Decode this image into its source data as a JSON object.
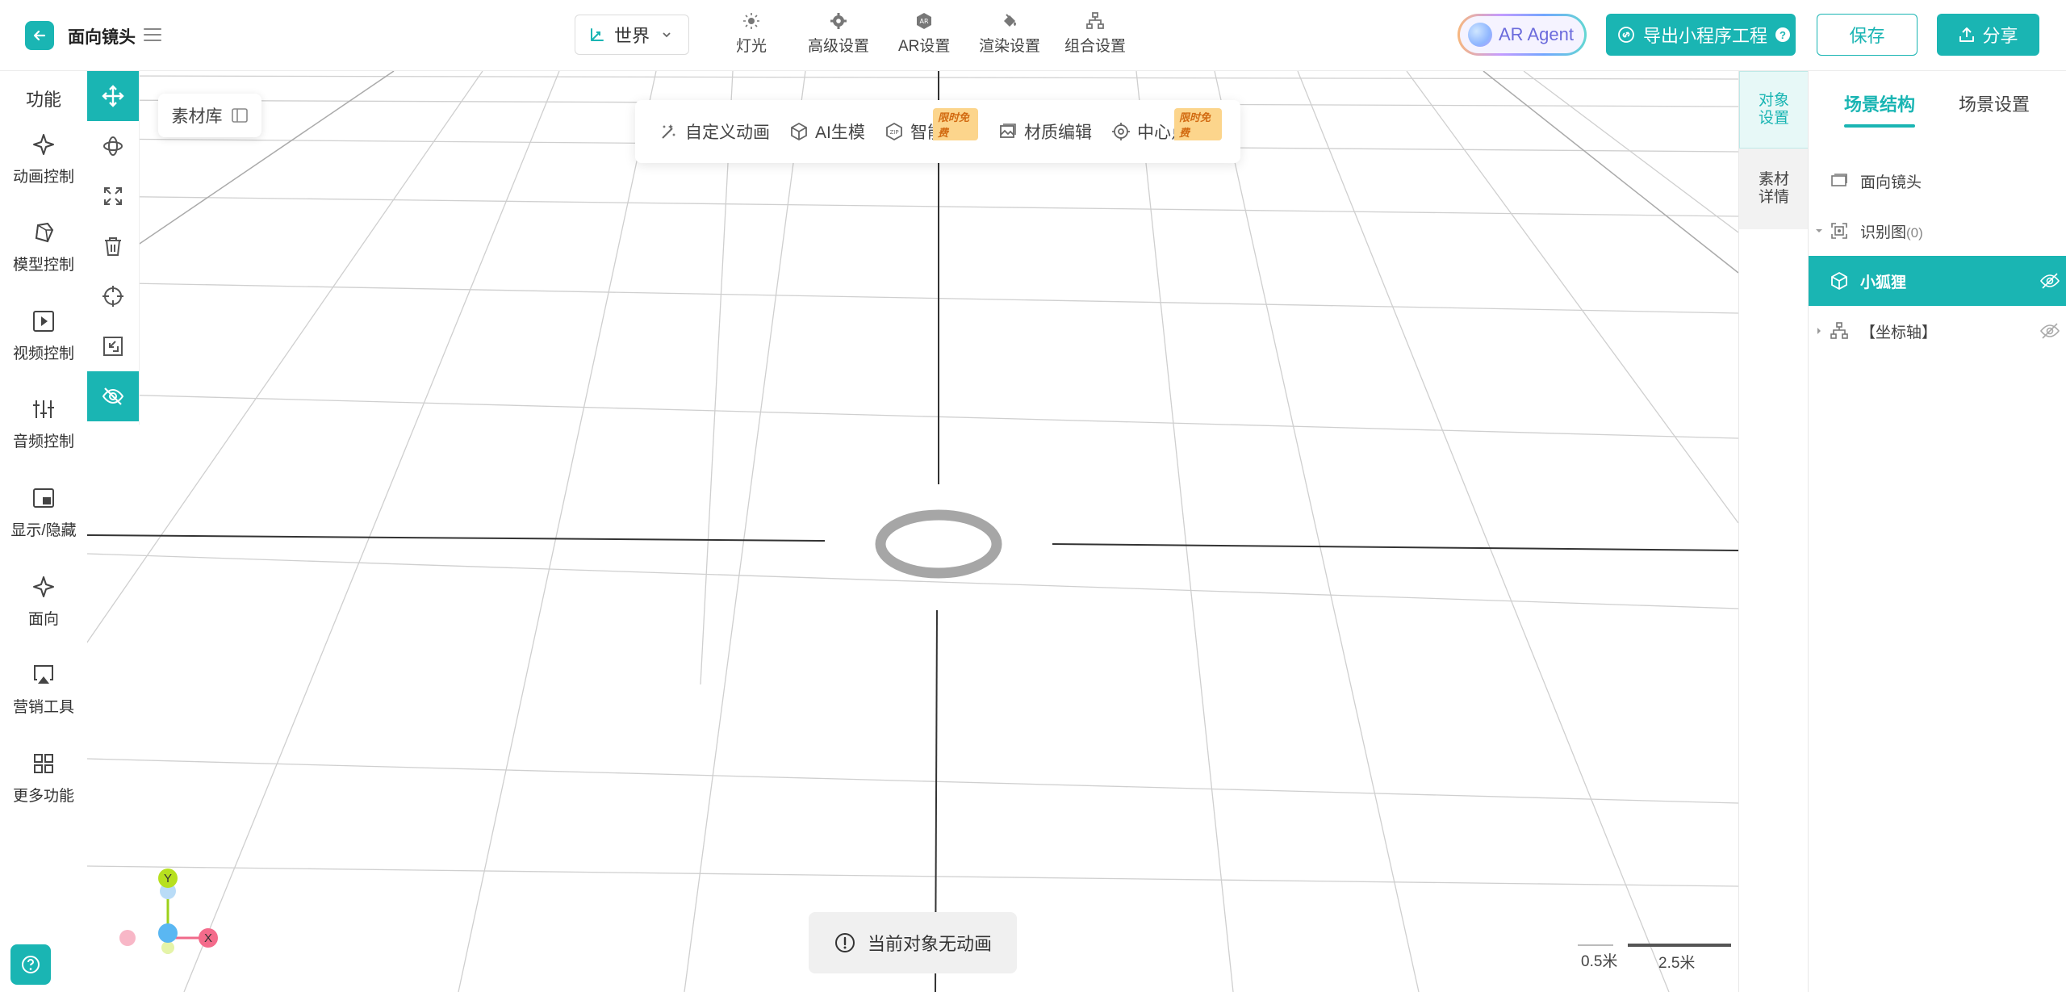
{
  "header": {
    "title": "面向镜头",
    "world_select": "世界",
    "tools": [
      {
        "label": "灯光",
        "icon": "light-icon"
      },
      {
        "label": "高级设置",
        "icon": "gear-icon"
      },
      {
        "label": "AR设置",
        "icon": "ar-icon"
      },
      {
        "label": "渲染设置",
        "icon": "paint-bucket-icon"
      },
      {
        "label": "组合设置",
        "icon": "hierarchy-icon"
      }
    ],
    "ar_agent_label": "AR Agent",
    "export_label": "导出小程序工程",
    "save_label": "保存",
    "share_label": "分享"
  },
  "sidebar": {
    "title": "功能",
    "items": [
      {
        "label": "动画控制",
        "icon": "sparkle-icon"
      },
      {
        "label": "模型控制",
        "icon": "cube-icon"
      },
      {
        "label": "视频控制",
        "icon": "play-icon"
      },
      {
        "label": "音频控制",
        "icon": "equalizer-icon"
      },
      {
        "label": "显示/隐藏",
        "icon": "picture-in-picture-icon"
      },
      {
        "label": "面向",
        "icon": "sparkle-outline-icon"
      },
      {
        "label": "营销工具",
        "icon": "airplay-icon"
      },
      {
        "label": "更多功能",
        "icon": "grid-icon"
      }
    ]
  },
  "toolstrip": {
    "tools": [
      "move-icon",
      "rotate-icon",
      "scale-icon",
      "delete-icon",
      "target-icon",
      "fit-icon",
      "hide-icon"
    ]
  },
  "viewport": {
    "asset_library_label": "素材库",
    "toolbar": {
      "items": [
        {
          "label": "自定义动画",
          "icon": "magic-wand-icon",
          "badge": ""
        },
        {
          "label": "AI生模",
          "icon": "ai-cube-icon",
          "badge": ""
        },
        {
          "label": "智能优化",
          "icon": "zip-icon",
          "badge": "限时免费"
        },
        {
          "label": "材质编辑",
          "icon": "image-icon",
          "badge": ""
        },
        {
          "label": "中心点修改",
          "icon": "crosshair-icon",
          "badge": "限时免费"
        }
      ]
    },
    "toast_message": "当前对象无动画",
    "axis_labels": {
      "y": "Y",
      "x": "X"
    },
    "scale": {
      "small": "0.5米",
      "large": "2.5米"
    }
  },
  "right_tabs": [
    {
      "label_line1": "对象",
      "label_line2": "设置"
    },
    {
      "label_line1": "素材",
      "label_line2": "详情"
    }
  ],
  "scene_panel": {
    "tabs": [
      "场景结构",
      "场景设置"
    ],
    "tree": [
      {
        "label": "面向镜头",
        "count": ""
      },
      {
        "label": "识别图",
        "count": "(0)"
      },
      {
        "label": "小狐狸",
        "count": ""
      },
      {
        "label": "【坐标轴】",
        "count": ""
      }
    ]
  },
  "colors": {
    "accent": "#1ab5b3",
    "badge": "#fcd58c"
  }
}
